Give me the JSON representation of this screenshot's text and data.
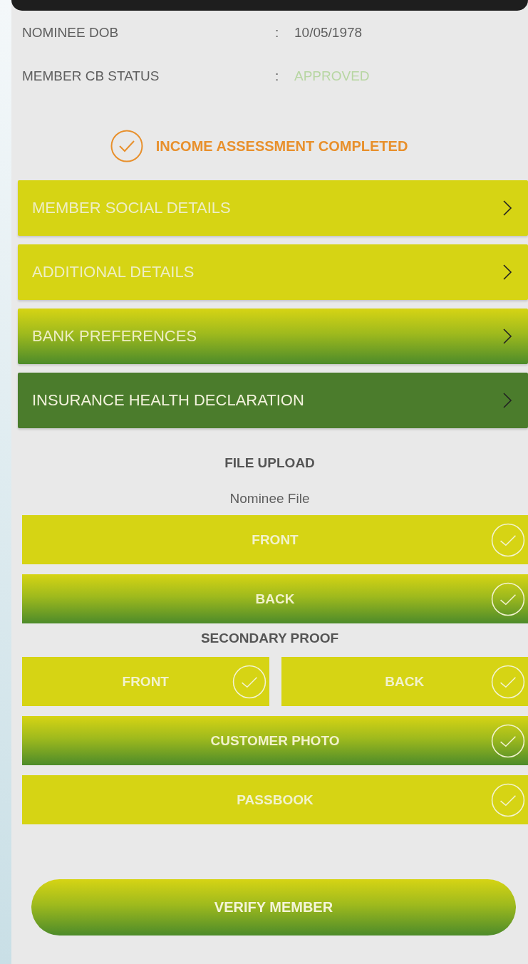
{
  "details": [
    {
      "label": "NOMINEE DOB",
      "separator": ":",
      "value": "10/05/1978",
      "kind": "text"
    },
    {
      "label": "MEMBER CB STATUS",
      "separator": ":",
      "value": "APPROVED",
      "kind": "status"
    }
  ],
  "assessment": {
    "text": "INCOME ASSESSMENT COMPLETED",
    "checked": true
  },
  "sections": [
    {
      "label": "MEMBER SOCIAL DETAILS",
      "kind": "flat"
    },
    {
      "label": "ADDITIONAL DETAILS",
      "kind": "flat"
    },
    {
      "label": "BANK PREFERENCES",
      "kind": "gradient"
    },
    {
      "label": "INSURANCE HEALTH DECLARATION",
      "kind": "solid"
    }
  ],
  "file_upload": {
    "title": "FILE UPLOAD",
    "groups": [
      {
        "title": "Nominee File",
        "kind": "normal",
        "rows": [
          [
            {
              "label": "FRONT",
              "kind": "flat",
              "checked": true
            }
          ],
          [
            {
              "label": "BACK",
              "kind": "gradient",
              "checked": true
            }
          ]
        ]
      },
      {
        "title": "SECONDARY PROOF",
        "kind": "bold",
        "rows": [
          [
            {
              "label": "FRONT",
              "kind": "flat",
              "checked": true
            },
            {
              "label": "BACK",
              "kind": "flat",
              "checked": true
            }
          ],
          [
            {
              "label": "CUSTOMER PHOTO",
              "kind": "gradient",
              "checked": true
            }
          ],
          [
            {
              "label": "PASSBOOK",
              "kind": "flat",
              "checked": true
            }
          ]
        ]
      }
    ]
  },
  "verify_button": {
    "label": "VERIFY MEMBER"
  }
}
